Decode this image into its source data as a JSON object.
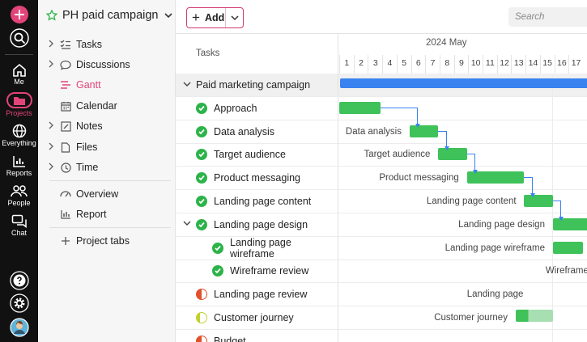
{
  "rail": {
    "items": [
      {
        "name": "add-icon",
        "label": ""
      },
      {
        "name": "search-icon",
        "label": ""
      },
      {
        "name": "home-icon",
        "label": "Me"
      },
      {
        "name": "folder-icon",
        "label": "Projects"
      },
      {
        "name": "globe-icon",
        "label": "Everything"
      },
      {
        "name": "reports-icon",
        "label": "Reports"
      },
      {
        "name": "people-icon",
        "label": "People"
      },
      {
        "name": "chat-icon",
        "label": "Chat"
      }
    ],
    "bottom": [
      "help-icon",
      "settings-icon",
      "avatar"
    ]
  },
  "project": {
    "title": "PH paid campaign"
  },
  "nav": {
    "items": [
      {
        "label": "Tasks",
        "icon": "checklist-icon",
        "chevron": true
      },
      {
        "label": "Discussions",
        "icon": "speech-bubble-icon",
        "chevron": true
      },
      {
        "label": "Gantt",
        "icon": "gantt-icon",
        "chevron": false,
        "active": true
      },
      {
        "label": "Calendar",
        "icon": "calendar-icon",
        "chevron": false
      },
      {
        "label": "Notes",
        "icon": "note-icon",
        "chevron": true
      },
      {
        "label": "Files",
        "icon": "file-icon",
        "chevron": true
      },
      {
        "label": "Time",
        "icon": "clock-icon",
        "chevron": true
      },
      {
        "label": "Overview",
        "icon": "overview-icon",
        "chevron": false
      },
      {
        "label": "Report",
        "icon": "report-icon",
        "chevron": false
      },
      {
        "label": "Project tabs",
        "icon": "plus-icon",
        "chevron": false
      }
    ]
  },
  "toolbar": {
    "add_label": "Add",
    "search_placeholder": "Search"
  },
  "gantt_header": {
    "tasks_label": "Tasks",
    "month": "2024 May",
    "days": [
      "1",
      "2",
      "3",
      "4",
      "5",
      "6",
      "7",
      "8",
      "9",
      "10",
      "11",
      "12",
      "13",
      "14",
      "15",
      "16",
      "17"
    ]
  },
  "rows": [
    {
      "name": "Paid marketing campaign",
      "status": "none",
      "summary": true,
      "chevron": true,
      "indent": 0
    },
    {
      "name": "Approach",
      "status": "done",
      "indent": 0
    },
    {
      "name": "Data analysis",
      "status": "done",
      "indent": 0
    },
    {
      "name": "Target audience",
      "status": "done",
      "indent": 0
    },
    {
      "name": "Product messaging",
      "status": "done",
      "indent": 0
    },
    {
      "name": "Landing page content",
      "status": "done",
      "indent": 0
    },
    {
      "name": "Landing page design",
      "status": "done",
      "chevron": true,
      "indent": 0
    },
    {
      "name": "Landing page wireframe",
      "status": "done",
      "indent": 1
    },
    {
      "name": "Wireframe review",
      "status": "done",
      "indent": 1
    },
    {
      "name": "Landing page review",
      "status": "in-progress",
      "indent": 0
    },
    {
      "name": "Customer journey",
      "status": "todo",
      "indent": 0
    },
    {
      "name": "Budget",
      "status": "in-progress",
      "indent": 0
    }
  ],
  "bar_labels": [
    "Data analysis",
    "Target audience",
    "Product messaging",
    "Landing page content",
    "Landing page design",
    "Landing page wireframe",
    "Wireframe rev",
    "Landing page",
    "Customer journey"
  ],
  "colors": {
    "accent": "#e2447a",
    "green": "#3fc25a",
    "blue": "#3a82f0"
  }
}
